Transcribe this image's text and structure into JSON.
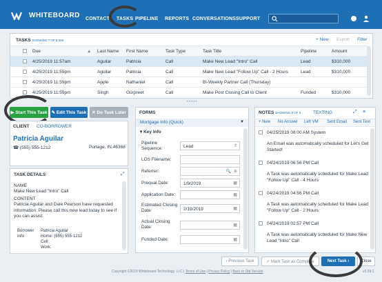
{
  "nav": {
    "brand": "WHITEBOARD",
    "items": [
      "CONTACT",
      "TASKS",
      "PIPELINE",
      "REPORTS",
      "CONVERSATIONS",
      "SUPPORT"
    ]
  },
  "tasks": {
    "title": "TASKS",
    "showing": "SHOWING 7 OF 8,569",
    "new_label": "+ New",
    "export_label": "Export",
    "filter_label": "Filter",
    "columns": [
      "Due",
      "Last Name",
      "First Name",
      "Task Type",
      "Task Title",
      "Pipeline",
      "Amount"
    ],
    "rows": [
      {
        "due": "4/25/2019 11:57am",
        "last": "Aguilar",
        "first": "Patricia",
        "type": "Call",
        "title": "Make New Lead \"Intro\" Call",
        "pipeline": "Lead",
        "amount": "$310,000"
      },
      {
        "due": "4/25/2019 11:59pm",
        "last": "Aguilar",
        "first": "Patricia",
        "type": "Call",
        "title": "Make New Lead \"Follow Up\" Call - 2 Hours",
        "pipeline": "Lead",
        "amount": "$310,000"
      },
      {
        "due": "4/25/2019 11:59pm",
        "last": "Apple",
        "first": "Nathaniel",
        "type": "Call",
        "title": "Bi-Weekly Partner Call (Thursday)",
        "pipeline": "",
        "amount": ""
      },
      {
        "due": "4/25/2019 11:59pm",
        "last": "Singh",
        "first": "Gurpreet",
        "type": "Call",
        "title": "Make Post Closing Call to Client",
        "pipeline": "Funded",
        "amount": "$310,000"
      }
    ]
  },
  "actions": {
    "start": "Start This Task",
    "edit": "Edit This Task",
    "dont": "Do Task Later"
  },
  "client": {
    "tab_client": "CLIENT",
    "tab_borrower": "CO-BORROWER",
    "name": "Patricia Aguilar",
    "phone": "(555) 555-1212",
    "location": "Portage, IN 46368"
  },
  "detail": {
    "title": "TASK DETAILS",
    "name_label": "NAME",
    "name_value": "Make New Lead \"Intro\" Call",
    "content_label": "CONTENT",
    "content_value": "Patricia Aguilar and Dale Pearson have requested information. Please call this new lead today to see if you can assist:",
    "borrower_label": "Borrower Info",
    "borrower_name": "Patricia Aguilar",
    "home": "Home: (555) 555-1212",
    "cell": "Cell:",
    "work": "Work:"
  },
  "forms": {
    "title": "FORMS",
    "dropdown": "Mortgage Info (Quick)",
    "section": "Key Info",
    "fields": [
      {
        "label": "Pipeline Sequence:",
        "value": "Lead"
      },
      {
        "label": "LOS Filename:",
        "value": ""
      },
      {
        "label": "Referrer:",
        "value": ""
      },
      {
        "label": "Prequal Date:",
        "value": "1/9/2019"
      },
      {
        "label": "Application Date:",
        "value": ""
      },
      {
        "label": "Estimated Closing Date:",
        "value": "2/19/2019"
      },
      {
        "label": "Actual Closing Date:",
        "value": ""
      },
      {
        "label": "Funded Date:",
        "value": ""
      }
    ]
  },
  "notes": {
    "title": "NOTES",
    "showing": "SHOWING 8 OF 8",
    "texting": "TEXTING",
    "toolbar": [
      "+ New",
      "No Answer",
      "Left VM",
      "Sent Email",
      "Sent Text"
    ],
    "items": [
      {
        "head": "04/25/2019 08:00 AM  System",
        "body": "An Email was automatically scheduled for Let's Get Started!"
      },
      {
        "head": "04/24/2019 06:56 PM  Call",
        "body": "A Task was automatically scheduled for Make Lead \"Follow Up\" Call - 4 Hours"
      },
      {
        "head": "04/24/2019 04:56 PM  Call",
        "body": "A Task was automatically scheduled for Make Lead \"Follow Up\" Call - 2 Hours"
      },
      {
        "head": "04/24/2019 02:57 PM  Call",
        "body": "A Task was automatically scheduled for Make New Lead \"Intro\" Call"
      }
    ]
  },
  "bottom": {
    "prev": "‹ Previous Task",
    "complete": "✓ Mark Task as Complete",
    "next": "Next Task ›",
    "close": "Close"
  },
  "footer": {
    "copyright": "Copyright ©2019 Whiteboard Technology, LLC",
    "terms": "Terms of Use",
    "privacy": "Privacy Policy",
    "old": "Back to Old Version",
    "version": "v2.39.1"
  },
  "colors": {
    "brand": "#1f6fb4",
    "start": "#2aa043",
    "edit": "#1f6fb4",
    "dont": "#9aa6b0"
  }
}
